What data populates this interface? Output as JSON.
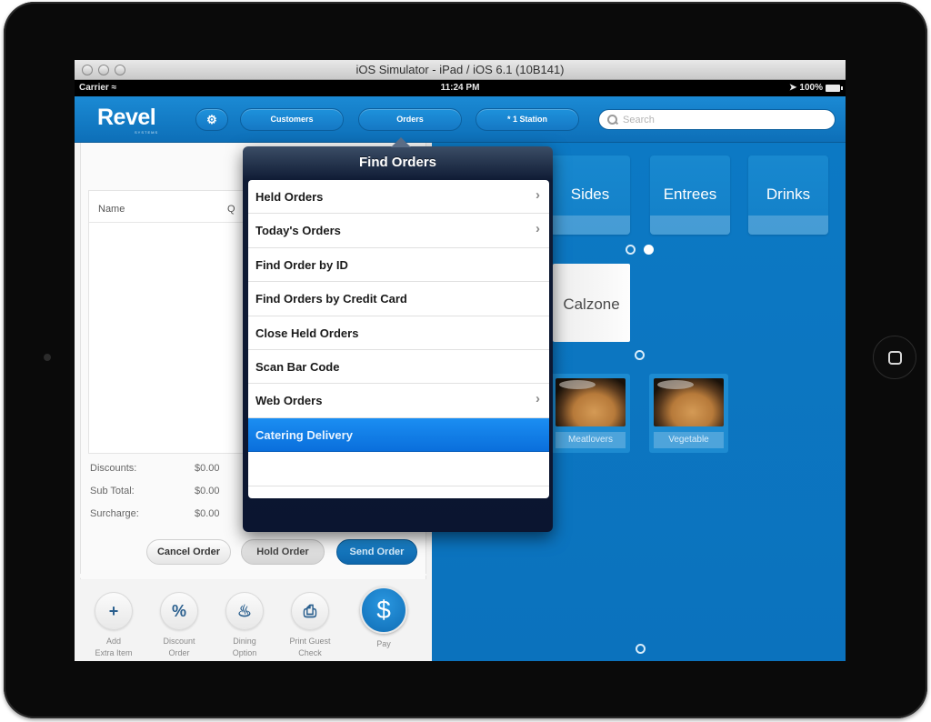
{
  "simulator": {
    "window_title": "iOS Simulator - iPad / iOS 6.1 (10B141)"
  },
  "status_bar": {
    "carrier": "Carrier",
    "time": "11:24 PM",
    "battery": "100%"
  },
  "navbar": {
    "logo": "Revel",
    "logo_sub": "SYSTEMS",
    "customers_label": "Customers",
    "orders_label": "Orders",
    "station_label": "* 1 Station",
    "search_placeholder": "Search"
  },
  "order": {
    "columns": [
      "Name",
      "Q"
    ],
    "totals": [
      {
        "label": "Discounts:",
        "value": "$0.00"
      },
      {
        "label": "Sub Total:",
        "value": "$0.00"
      },
      {
        "label": "Surcharge:",
        "value": "$0.00"
      }
    ],
    "buttons": {
      "cancel": "Cancel Order",
      "hold": "Hold Order",
      "send": "Send Order"
    },
    "actions": [
      {
        "glyph": "+",
        "label": "Add\nExtra Item"
      },
      {
        "glyph": "%",
        "label": "Discount\nOrder"
      },
      {
        "glyph": "♨",
        "label": "Dining\nOption"
      },
      {
        "glyph": "⎙",
        "label": "Print Guest\nCheck"
      },
      {
        "glyph": "$",
        "label": "Pay"
      }
    ]
  },
  "menu": {
    "categories": [
      "Sides",
      "Entrees",
      "Drinks"
    ],
    "category_page": {
      "current": 2,
      "total": 2
    },
    "products": [
      {
        "name": "Calzone"
      },
      {
        "name": "Meatlovers"
      },
      {
        "name": "Vegetable"
      }
    ]
  },
  "find_orders": {
    "title": "Find Orders",
    "items": [
      {
        "label": "Held Orders",
        "chevron": "›"
      },
      {
        "label": "Today's Orders",
        "chevron": "›"
      },
      {
        "label": "Find Order by ID",
        "chevron": ""
      },
      {
        "label": "Find Orders by Credit Card",
        "chevron": ""
      },
      {
        "label": "Close Held Orders",
        "chevron": ""
      },
      {
        "label": "Scan Bar Code",
        "chevron": ""
      },
      {
        "label": "Web Orders",
        "chevron": "›"
      },
      {
        "label": "Catering Delivery",
        "chevron": ""
      }
    ],
    "selected": "Catering Delivery"
  },
  "colors": {
    "brand_blue": "#0c79c4",
    "selection_blue": "#1b8ef2",
    "popover_dark": "#0e1a33"
  }
}
